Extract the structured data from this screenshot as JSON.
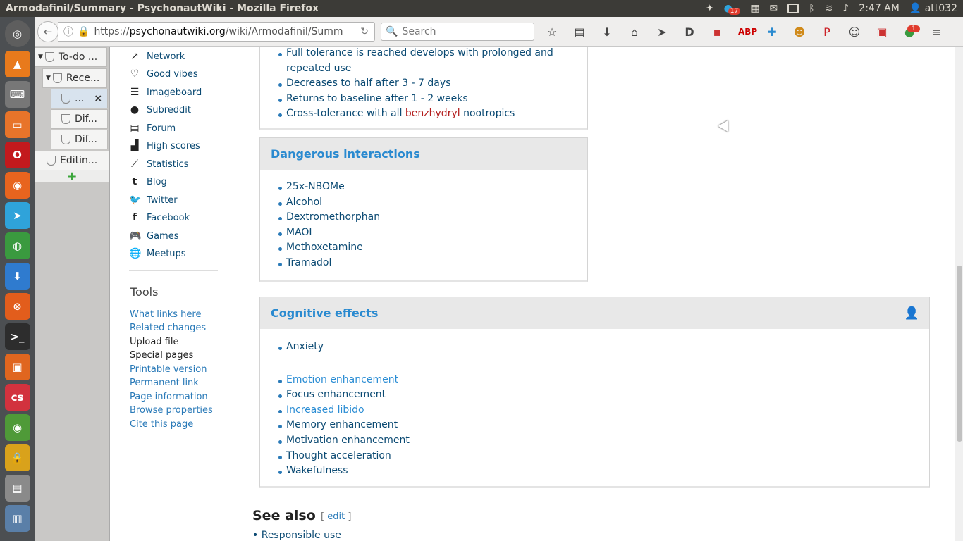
{
  "window": {
    "title": "Armodafinil/Summary - PsychonautWiki - Mozilla Firefox"
  },
  "topbar": {
    "time": "2:47 AM",
    "user": "att032",
    "telegram_badge": "17"
  },
  "browser": {
    "url_prefix": "https://",
    "url_host": "psychonautwiki.org",
    "url_path": "/wiki/Armodafinil/Summ",
    "search_placeholder": "Search",
    "notify_badge": "1"
  },
  "tree": {
    "nodes": [
      {
        "label": "To-do ..."
      },
      {
        "label": "Rece..."
      },
      {
        "label": "..."
      },
      {
        "label": "Dif..."
      },
      {
        "label": "Dif..."
      },
      {
        "label": "Editin..."
      }
    ],
    "close": "×",
    "add": "+"
  },
  "sidebar": {
    "items": [
      {
        "label": "Network",
        "icon": "external-link-icon"
      },
      {
        "label": "Good vibes",
        "icon": "heart-icon"
      },
      {
        "label": "Imageboard",
        "icon": "list-icon"
      },
      {
        "label": "Subreddit",
        "icon": "reddit-icon"
      },
      {
        "label": "Forum",
        "icon": "forum-icon"
      },
      {
        "label": "High scores",
        "icon": "bar-chart-icon"
      },
      {
        "label": "Statistics",
        "icon": "line-chart-icon"
      },
      {
        "label": "Blog",
        "icon": "tumblr-icon"
      },
      {
        "label": "Twitter",
        "icon": "twitter-icon"
      },
      {
        "label": "Facebook",
        "icon": "facebook-icon"
      },
      {
        "label": "Games",
        "icon": "gamepad-icon"
      },
      {
        "label": "Meetups",
        "icon": "globe-icon"
      }
    ],
    "tools_heading": "Tools",
    "tools": [
      "What links here",
      "Related changes",
      "Upload file",
      "Special pages",
      "Printable version",
      "Permanent link",
      "Page information",
      "Browse properties",
      "Cite this page"
    ]
  },
  "tolerance": {
    "items": [
      "Full tolerance is reached develops with prolonged and repeated use",
      "Decreases to half after 3 - 7 days",
      "Returns to baseline after 1 - 2 weeks"
    ],
    "cross_prefix": "Cross-tolerance with all ",
    "cross_link": "benzhydryl",
    "cross_suffix": " nootropics"
  },
  "interactions": {
    "heading": "Dangerous interactions",
    "items": [
      "25x-NBOMe",
      "Alcohol",
      "Dextromethorphan",
      "MAOI",
      "Methoxetamine",
      "Tramadol"
    ]
  },
  "cognitive": {
    "heading": "Cognitive effects",
    "top": [
      "Anxiety"
    ],
    "items": [
      "Emotion enhancement",
      "Focus enhancement",
      "Increased libido",
      "Memory enhancement",
      "Motivation enhancement",
      "Thought acceleration",
      "Wakefulness"
    ]
  },
  "see_also": {
    "heading": "See also",
    "edit": "edit",
    "item": "Responsible use"
  }
}
